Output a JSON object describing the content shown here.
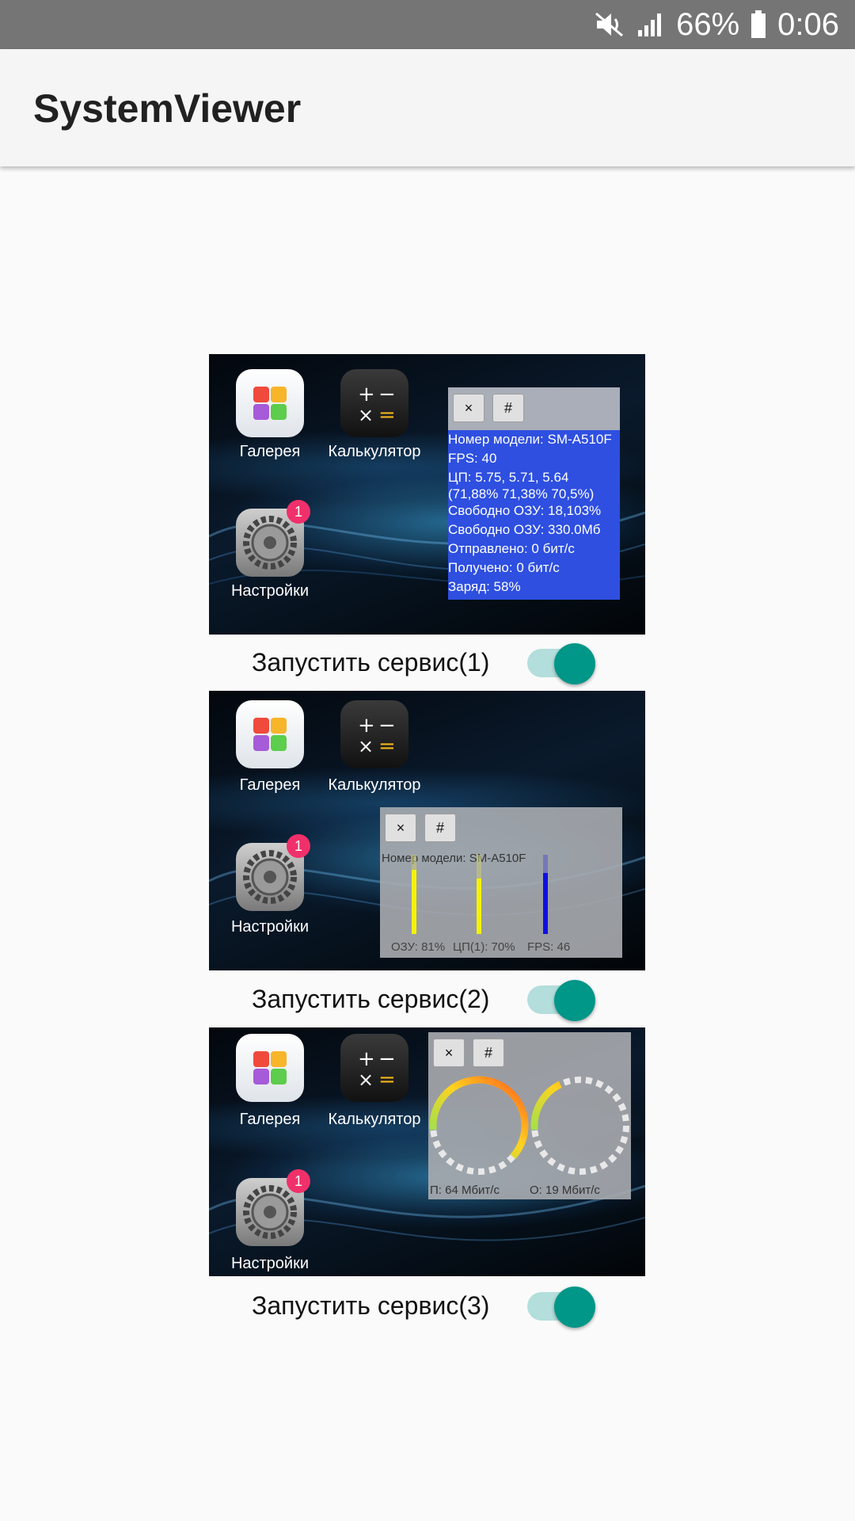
{
  "status_bar": {
    "battery_text": "66%",
    "time": "0:06",
    "icons": [
      "mute-icon",
      "signal-icon",
      "battery-icon"
    ]
  },
  "app_bar": {
    "title": "SystemViewer"
  },
  "apps": {
    "gallery": "Галерея",
    "calculator": "Калькулятор",
    "settings": "Настройки",
    "settings_badge": "1"
  },
  "overlay_buttons": {
    "close": "×",
    "hash": "#"
  },
  "overlay1": {
    "lines": [
      "Номер модели: SM-A510F",
      "FPS: 40",
      "ЦП: 5.75, 5.71, 5.64",
      "(71,88% 71,38% 70,5%)",
      "Свободно ОЗУ: 18,103%",
      "Свободно ОЗУ: 330.0Мб",
      "Отправлено: 0 бит/с",
      "Получено: 0 бит/с",
      "Заряд: 58%"
    ]
  },
  "overlay2": {
    "model": "Номер модели: SM-A510F",
    "bars": [
      {
        "label": "ОЗУ: 81%",
        "level": 0.81,
        "color": "#f5f200"
      },
      {
        "label": "ЦП(1): 70%",
        "level": 0.7,
        "color": "#f5f200"
      },
      {
        "label": "FPS: 46",
        "level": 0.77,
        "color": "#1010e0"
      }
    ]
  },
  "overlay3": {
    "upload_label": "П: 64 Мбит/с",
    "download_label": "О: 19 Мбит/с"
  },
  "services": [
    {
      "label": "Запустить сервис(1)",
      "enabled": true
    },
    {
      "label": "Запустить сервис(2)",
      "enabled": true
    },
    {
      "label": "Запустить сервис(3)",
      "enabled": true
    }
  ],
  "colors": {
    "accent": "#009688",
    "switch_track": "#b3dedb",
    "badge": "#f0306a"
  }
}
